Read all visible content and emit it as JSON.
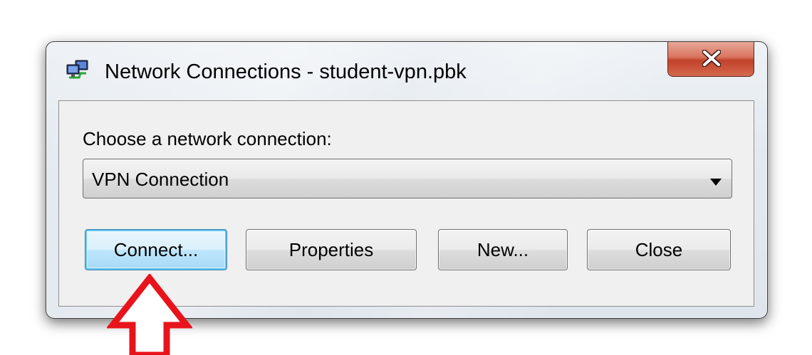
{
  "window": {
    "title": "Network Connections - student-vpn.pbk",
    "app_icon": "network-connections-icon",
    "close_icon": "close-x-icon"
  },
  "dialog": {
    "prompt_label": "Choose a network connection:",
    "connection_select": {
      "selected_value": "VPN Connection",
      "arrow_icon": "dropdown-arrow-icon"
    },
    "buttons": {
      "connect": "Connect...",
      "properties": "Properties",
      "new": "New...",
      "close": "Close"
    }
  },
  "annotation": {
    "arrow_icon": "red-up-arrow-icon",
    "color": "#e8141b"
  },
  "colors": {
    "close_button": "#c2412a",
    "default_button_border": "#3c7fb1",
    "default_button_glow": "#63c6f3"
  }
}
